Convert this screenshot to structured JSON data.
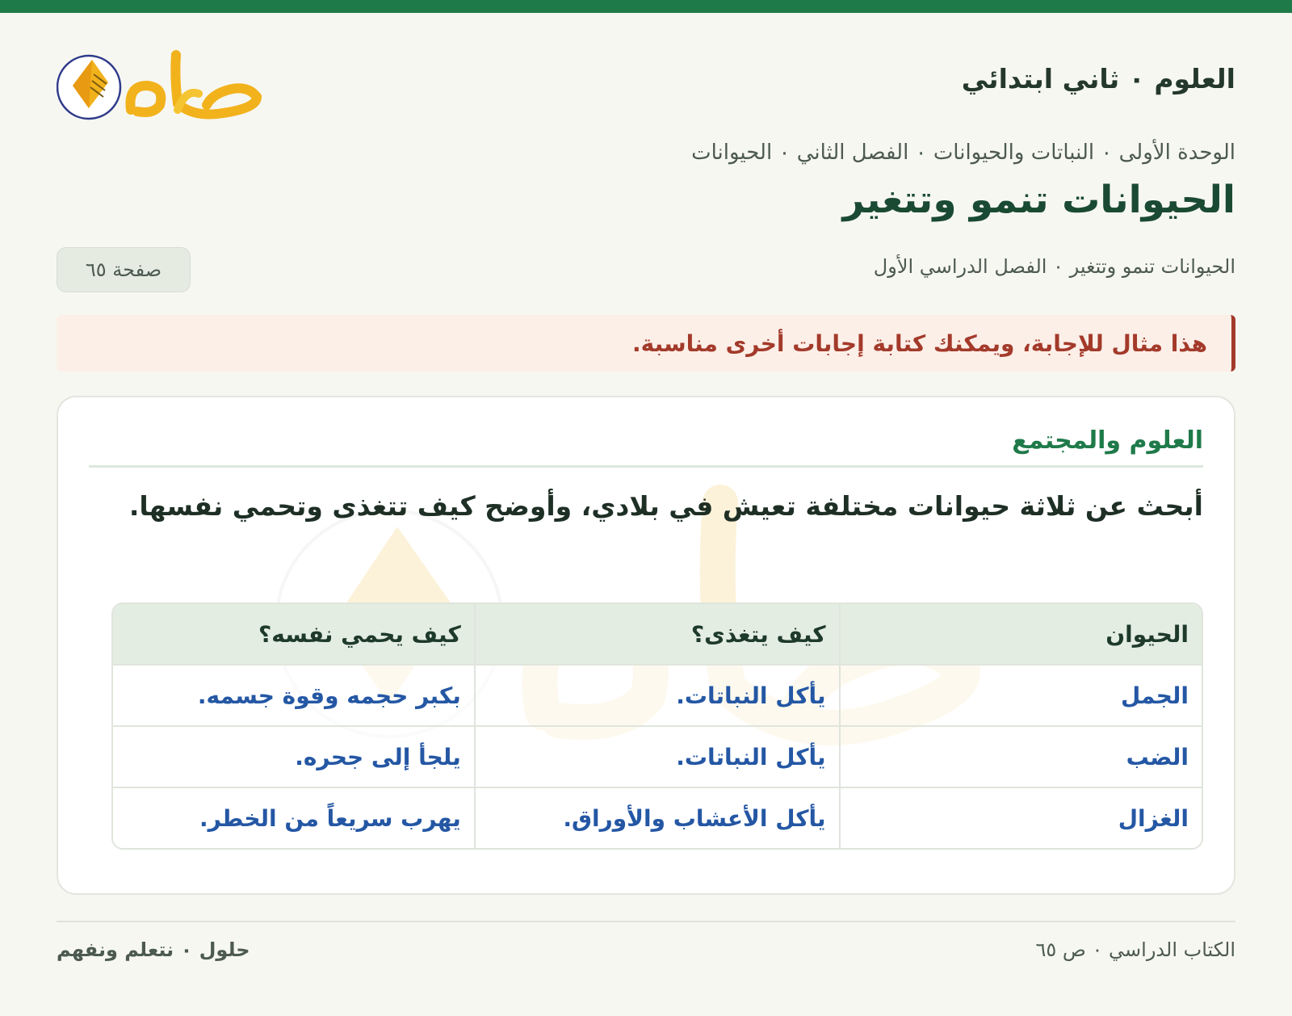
{
  "header": {
    "subject": "العلوم ٠ ثاني ابتدائي",
    "logo_text": "حلول"
  },
  "breadcrumb": "الوحدة الأولى ٠ النباتات والحيوانات ٠ الفصل الثاني ٠ الحيوانات",
  "lesson": {
    "title": "الحيوانات تنمو وتتغير",
    "subline": "الحيوانات تنمو وتتغير ٠ الفصل الدراسي الأول",
    "page_badge": "صفحة ٦٥"
  },
  "note": "هذا مثال للإجابة، ويمكنك كتابة إجابات أخرى مناسبة.",
  "card": {
    "heading": "العلوم والمجتمع",
    "prompt": "أبحث عن ثلاثة حيوانات مختلفة تعيش في بلادي، وأوضح كيف تتغذى وتحمي نفسها.",
    "table": {
      "headers": [
        "الحيوان",
        "كيف يتغذى؟",
        "كيف يحمي نفسه؟"
      ],
      "rows": [
        [
          "الجمل",
          "يأكل النباتات.",
          "بكبر حجمه وقوة جسمه."
        ],
        [
          "الضب",
          "يأكل النباتات.",
          "يلجأ إلى جحره."
        ],
        [
          "الغزال",
          "يأكل الأعشاب والأوراق.",
          "يهرب سريعاً من الخطر."
        ]
      ]
    }
  },
  "footer": {
    "right": "الكتاب الدراسي ٠ ص ٦٥",
    "left": "حلول ٠ نتعلم ونفهم"
  },
  "colors": {
    "brand_green": "#1f7a4a",
    "note_red": "#a33a2a",
    "answer_blue": "#2457a4",
    "logo_gold": "#f2b21c"
  }
}
